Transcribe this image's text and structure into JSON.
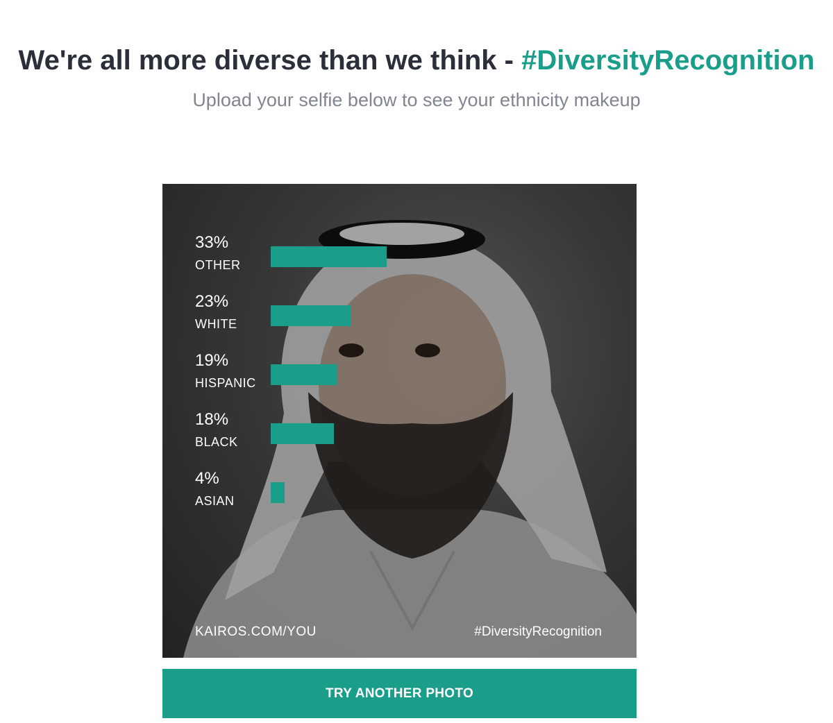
{
  "header": {
    "title_main": "We're all more diverse than we think - ",
    "title_hashtag": "#DiversityRecognition",
    "subtitle": "Upload your selfie below to see your ethnicity makeup"
  },
  "colors": {
    "accent": "#1a9e8a",
    "title_text": "#2b2f3a",
    "subtitle_text": "#808590",
    "card_background": "#3a3a3a"
  },
  "result_card": {
    "image_description_icon": "portrait-photo",
    "chart_data": {
      "type": "bar",
      "categories": [
        "OTHER",
        "WHITE",
        "HISPANIC",
        "BLACK",
        "ASIAN"
      ],
      "values": [
        33,
        23,
        19,
        18,
        4
      ],
      "value_labels": [
        "33%",
        "23%",
        "19%",
        "18%",
        "4%"
      ],
      "unit": "%",
      "orientation": "horizontal"
    },
    "footer_left": "KAIROS.COM/YOU",
    "footer_right": "#DiversityRecognition"
  },
  "actions": {
    "try_another_label": "TRY ANOTHER PHOTO"
  }
}
